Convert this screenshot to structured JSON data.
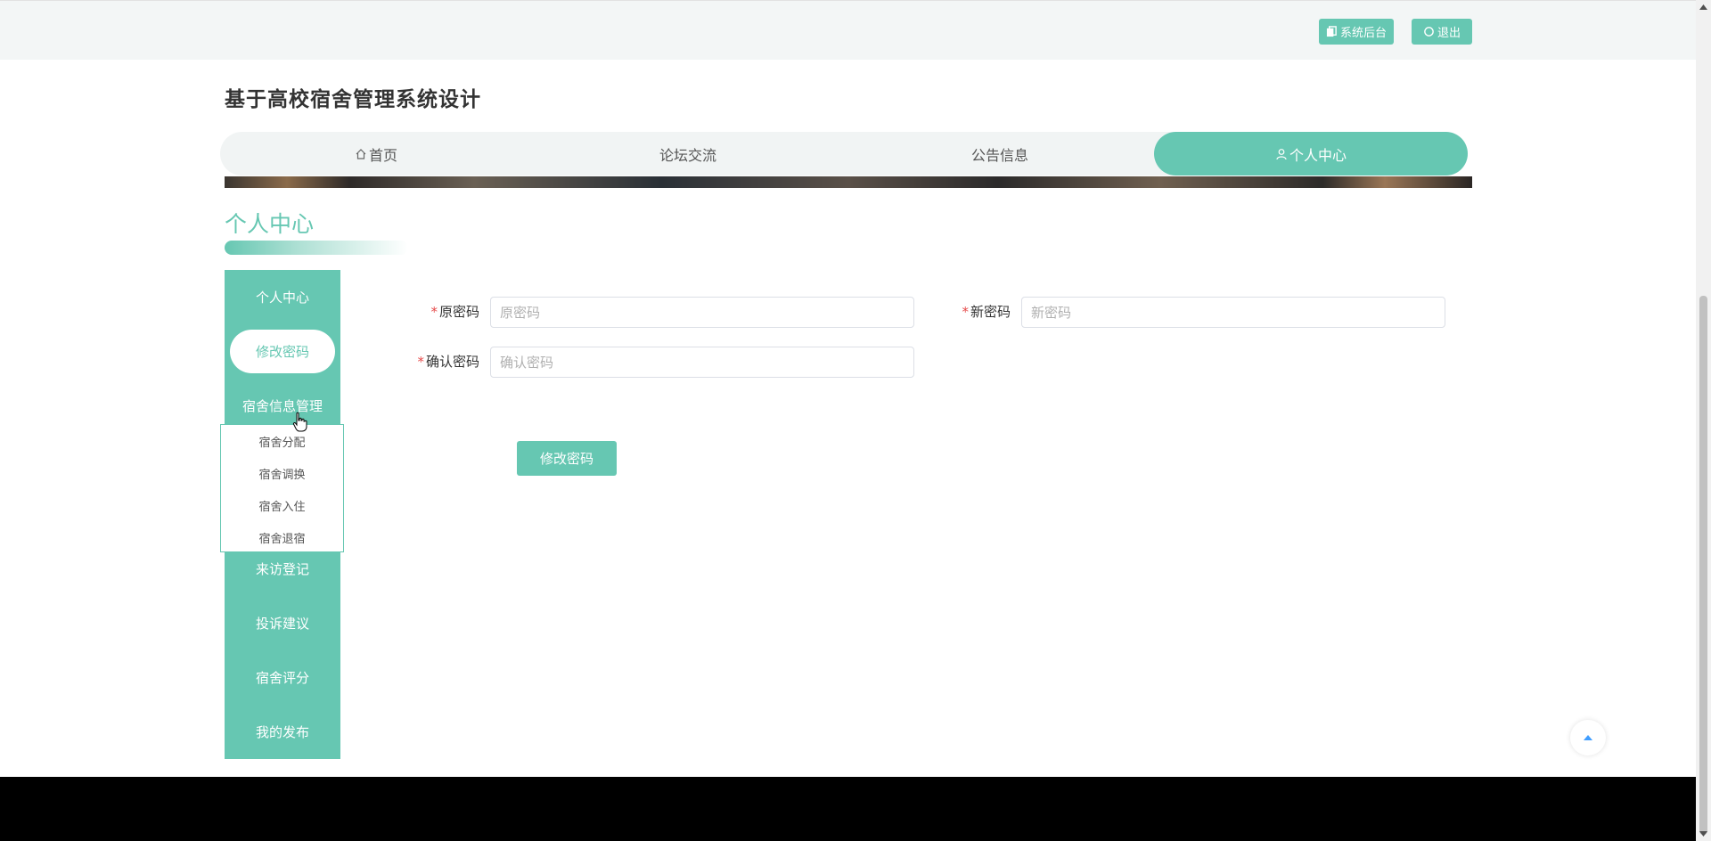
{
  "topbar": {
    "admin_label": "系统后台",
    "logout_label": "退出"
  },
  "site": {
    "title": "基于高校宿舍管理系统设计"
  },
  "nav": {
    "items": [
      {
        "label": "首页"
      },
      {
        "label": "论坛交流"
      },
      {
        "label": "公告信息"
      },
      {
        "label": "个人中心"
      }
    ],
    "active": "个人中心"
  },
  "section": {
    "title": "个人中心"
  },
  "sidebar": {
    "items": [
      {
        "label": "个人中心"
      },
      {
        "label": "修改密码"
      },
      {
        "label": "宿舍信息管理"
      },
      {
        "label": "来访登记"
      },
      {
        "label": "投诉建议"
      },
      {
        "label": "宿舍评分"
      },
      {
        "label": "我的发布"
      }
    ],
    "active": "修改密码",
    "submenu": [
      {
        "label": "宿舍分配"
      },
      {
        "label": "宿舍调换"
      },
      {
        "label": "宿舍入住"
      },
      {
        "label": "宿舍退宿"
      }
    ]
  },
  "form": {
    "old_password": {
      "label": "原密码",
      "placeholder": "原密码",
      "value": ""
    },
    "new_password": {
      "label": "新密码",
      "placeholder": "新密码",
      "value": ""
    },
    "confirm_password": {
      "label": "确认密码",
      "placeholder": "确认密码",
      "value": ""
    },
    "required_mark": "*",
    "submit_label": "修改密码"
  },
  "colors": {
    "accent": "#66c7b2",
    "required": "#e64b4b",
    "footer": "#000000"
  },
  "icons": {
    "admin": "copy-icon",
    "logout": "power-icon",
    "home": "home-icon",
    "user": "user-icon",
    "back_to_top": "caret-up-icon"
  }
}
